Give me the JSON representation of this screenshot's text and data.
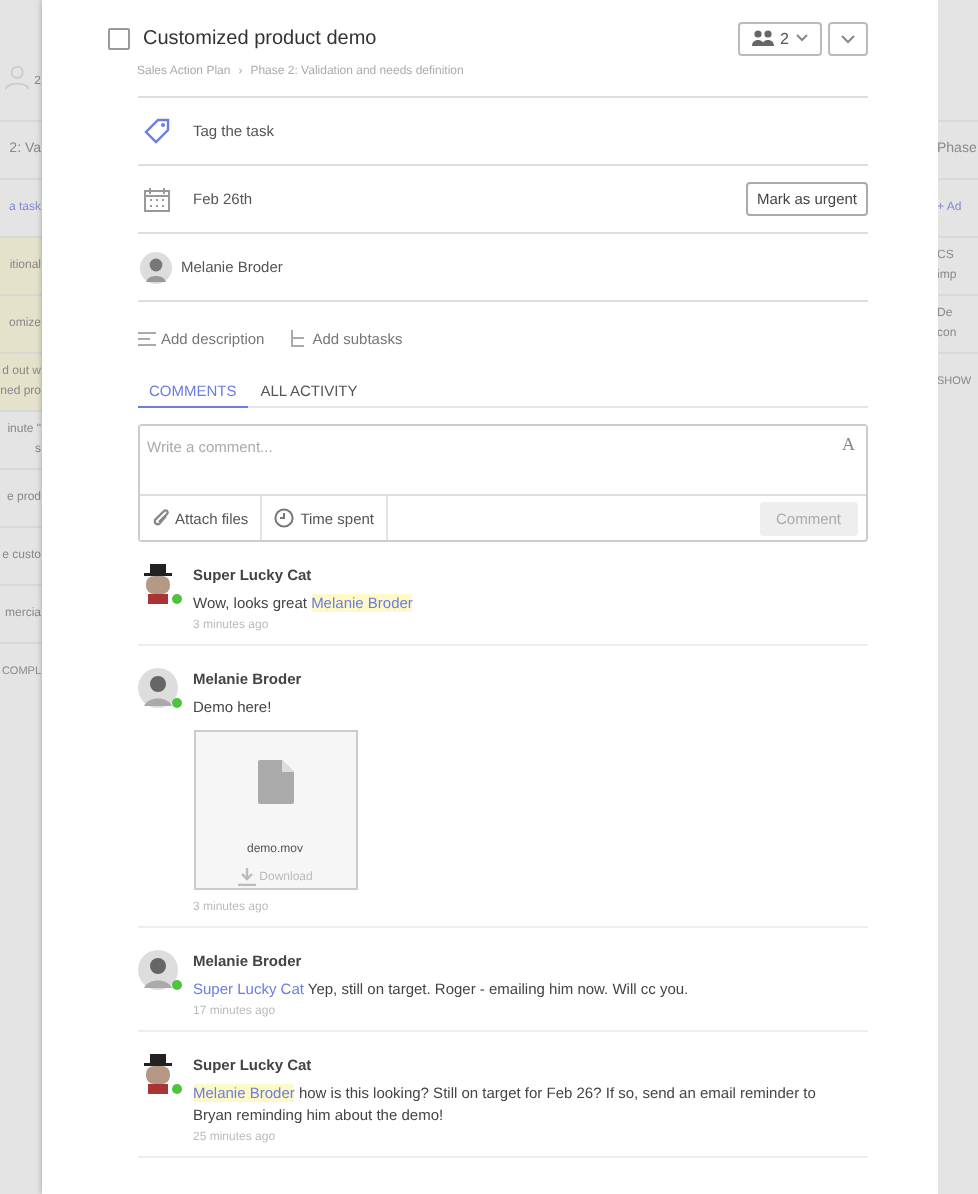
{
  "background_left": {
    "count": "2",
    "rows": [
      {
        "lines": [
          "2: Va"
        ],
        "kind": "heading",
        "highlighted": false
      },
      {
        "lines": [
          "a task"
        ],
        "kind": "link",
        "highlighted": false
      },
      {
        "lines": [
          "itional"
        ],
        "kind": "item",
        "highlighted": true
      },
      {
        "lines": [
          "omize"
        ],
        "kind": "item",
        "highlighted": true
      },
      {
        "lines": [
          "d out w",
          "ned pro"
        ],
        "kind": "item",
        "highlighted": true
      },
      {
        "lines": [
          "inute \"",
          "s"
        ],
        "kind": "item",
        "highlighted": false
      },
      {
        "lines": [
          "e prod"
        ],
        "kind": "item",
        "highlighted": false
      },
      {
        "lines": [
          "e custo"
        ],
        "kind": "item",
        "highlighted": false
      },
      {
        "lines": [
          "mercia"
        ],
        "kind": "item",
        "highlighted": false
      },
      {
        "lines": [
          "COMPL"
        ],
        "kind": "footer",
        "highlighted": false
      }
    ]
  },
  "background_right": {
    "rows": [
      {
        "lines": [
          "Phase"
        ],
        "kind": "heading"
      },
      {
        "lines": [
          "+ Ad"
        ],
        "kind": "link"
      },
      {
        "lines": [
          "CS",
          "imp"
        ],
        "kind": "item"
      },
      {
        "lines": [
          "De",
          "con"
        ],
        "kind": "item"
      },
      {
        "lines": [
          "SHOW"
        ],
        "kind": "footer"
      }
    ]
  },
  "task": {
    "title": "Customized product demo",
    "done": false,
    "assignee_count": "2",
    "breadcrumb": [
      "Sales Action Plan",
      "Phase 2: Validation and needs definition"
    ],
    "breadcrumb_separator": "›",
    "tag_label": "Tag the task",
    "due_date": "Feb 26th",
    "urgent_button": "Mark as urgent",
    "owner": "Melanie Broder",
    "actions": [
      "Add description",
      "Add subtasks"
    ]
  },
  "tabs": [
    {
      "label": "COMMENTS",
      "selected": true
    },
    {
      "label": "ALL ACTIVITY",
      "selected": false
    }
  ],
  "composer": {
    "placeholder": "Write a comment...",
    "format_icon": "A",
    "attach": "Attach files",
    "time": "Time spent",
    "submit": "Comment"
  },
  "comments": [
    {
      "author": "Super Lucky Cat",
      "kind": "cat",
      "online": true,
      "parts": [
        {
          "kind": "text",
          "text": "Wow, looks great "
        },
        {
          "kind": "mention",
          "text": "Melanie Broder",
          "highlighted": true
        }
      ],
      "time": "3 minutes ago"
    },
    {
      "author": "Melanie Broder",
      "kind": "person",
      "online": true,
      "parts": [
        {
          "kind": "text",
          "text": "Demo here!"
        }
      ],
      "attachment": {
        "name": "demo.mov",
        "action": "Download"
      },
      "time": "3 minutes ago"
    },
    {
      "author": "Melanie Broder",
      "kind": "person",
      "online": true,
      "parts": [
        {
          "kind": "mention",
          "text": "Super Lucky Cat",
          "highlighted": false
        },
        {
          "kind": "text",
          "text": " Yep, still on target. Roger - emailing him now. Will cc you."
        }
      ],
      "time": "17 minutes ago"
    },
    {
      "author": "Super Lucky Cat",
      "kind": "cat",
      "online": true,
      "parts": [
        {
          "kind": "mention",
          "text": "Melanie Broder",
          "highlighted": true
        },
        {
          "kind": "text",
          "text": " how is this looking? Still on target for Feb 26? If so, send an email reminder to Bryan reminding him about the demo!"
        }
      ],
      "time": "25 minutes ago"
    }
  ]
}
